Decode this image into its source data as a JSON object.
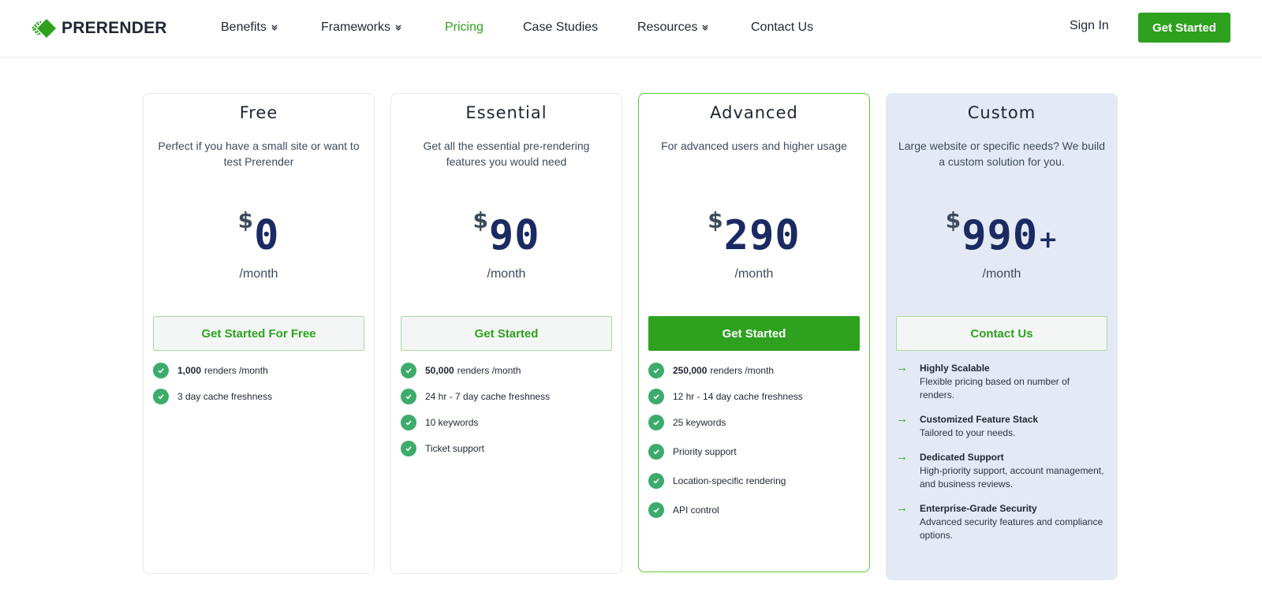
{
  "brand": {
    "name": "PRERENDER",
    "accent_color": "#2ea11f"
  },
  "nav": {
    "items": [
      {
        "label": "Benefits",
        "dropdown": true
      },
      {
        "label": "Frameworks",
        "dropdown": true
      },
      {
        "label": "Pricing",
        "dropdown": false,
        "active": true
      },
      {
        "label": "Case Studies",
        "dropdown": false
      },
      {
        "label": "Resources",
        "dropdown": true
      },
      {
        "label": "Contact Us",
        "dropdown": false
      }
    ],
    "sign_in": "Sign In",
    "cta": "Get Started"
  },
  "plans": [
    {
      "name": "Free",
      "description": "Perfect if you have a small site or want to test Prerender",
      "currency": "$",
      "price": "0",
      "suffix": "",
      "period": "/month",
      "button": "Get Started For Free",
      "features": [
        {
          "bold": "1,000",
          "text": "renders /month"
        },
        {
          "bold": "",
          "text": "3 day cache freshness"
        }
      ]
    },
    {
      "name": "Essential",
      "description": "Get all the essential pre-rendering features you would need",
      "currency": "$",
      "price": "90",
      "suffix": "",
      "period": "/month",
      "button": "Get Started",
      "features": [
        {
          "bold": "50,000",
          "text": "renders /month"
        },
        {
          "bold": "",
          "text": "24 hr - 7 day cache freshness"
        },
        {
          "bold": "",
          "text": "10 keywords"
        },
        {
          "bold": "",
          "text": "Ticket support"
        }
      ]
    },
    {
      "name": "Advanced",
      "description": "For advanced users and higher usage",
      "currency": "$",
      "price": "290",
      "suffix": "",
      "period": "/month",
      "button": "Get Started",
      "featured": true,
      "features": [
        {
          "bold": "250,000",
          "text": "renders /month"
        },
        {
          "bold": "",
          "text": "12 hr - 14 day cache freshness"
        },
        {
          "bold": "",
          "text": "25 keywords"
        },
        {
          "bold": "",
          "text": "Priority support"
        },
        {
          "bold": "",
          "text": "Location-specific rendering"
        },
        {
          "bold": "",
          "text": "API control"
        }
      ]
    },
    {
      "name": "Custom",
      "description": "Large website or specific needs? We build a custom solution for you.",
      "currency": "$",
      "price": "990",
      "suffix": "+",
      "period": "/month",
      "button": "Contact Us",
      "features": [
        {
          "title": "Highly Scalable",
          "text": "Flexible pricing based on number of renders."
        },
        {
          "title": "Customized Feature Stack",
          "text": "Tailored to your needs."
        },
        {
          "title": "Dedicated Support",
          "text": "High-priority support, account management, and business reviews."
        },
        {
          "title": "Enterprise-Grade Security",
          "text": "Advanced security features and compliance options."
        }
      ]
    }
  ]
}
